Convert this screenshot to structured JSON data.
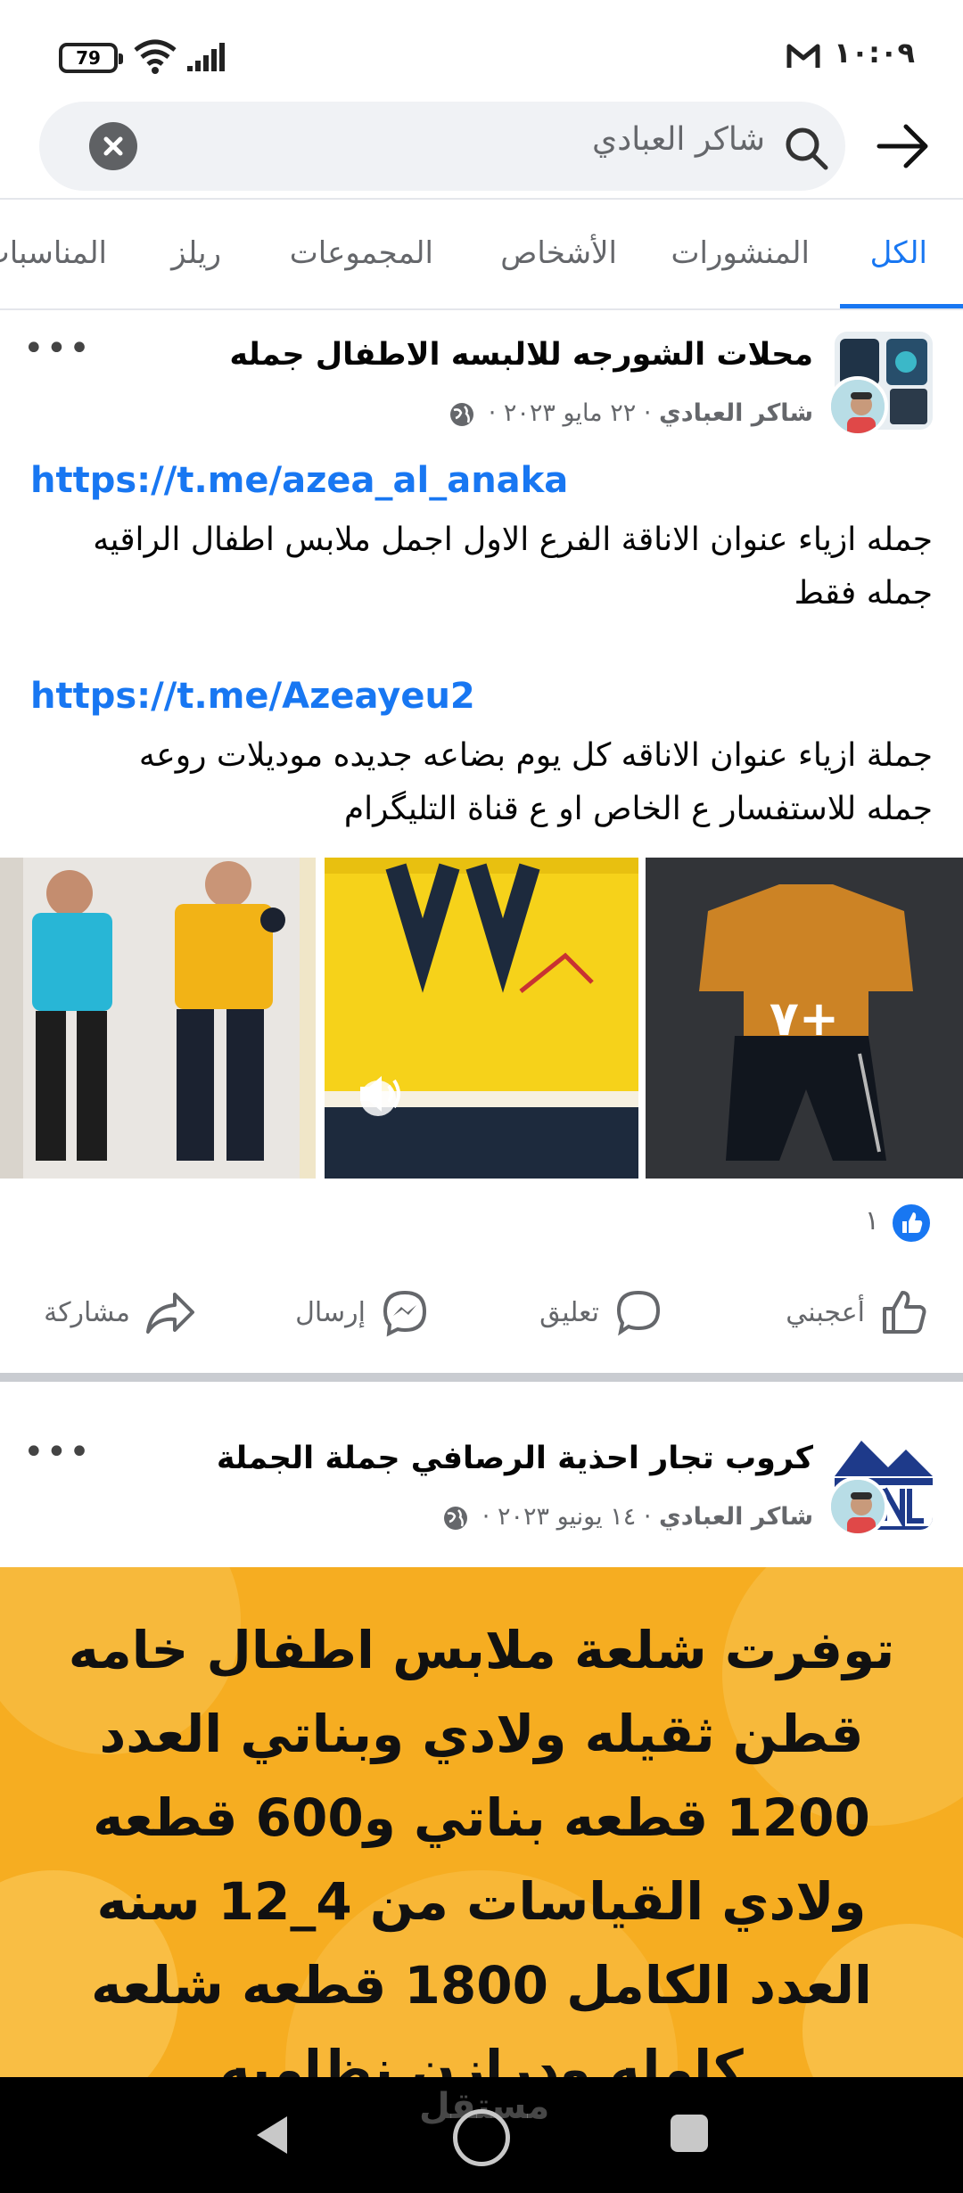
{
  "status_bar": {
    "battery": "79",
    "time": "١٠:٠٩"
  },
  "search": {
    "query": "شاكر العبادي"
  },
  "tabs": [
    {
      "label": "الكل",
      "active": true
    },
    {
      "label": "المنشورات"
    },
    {
      "label": "الأشخاص"
    },
    {
      "label": "المجموعات"
    },
    {
      "label": "ريلز"
    },
    {
      "label": "المناسبات"
    }
  ],
  "post1": {
    "group_name": "محلات الشورجه للالبسه الاطفال جمله",
    "author": "شاكر العبادي",
    "date": "· ٢٢ مايو ٢٠٢٣ ·",
    "link1": "https://t.me/azea_al_anaka",
    "text1_line1": "جمله ازياء عنوان الاناقة الفرع الاول اجمل ملابس اطفال الراقيه",
    "text1_line2": "جمله فقط",
    "link2": "https://t.me/Azeayeu2",
    "text2_line1": "جملة ازياء عنوان الاناقه كل يوم  بضاعه جديده موديلات روعه",
    "text2_line2": "جمله  للاستفسار ع الخاص او ع قناة التليگرام",
    "more_photos": "+٧",
    "reaction_count": "١",
    "actions": {
      "like": "أعجبني",
      "comment": "تعليق",
      "send": "إرسال",
      "share": "مشاركة"
    }
  },
  "post2": {
    "group_name": "كروب تجار احذية الرصافي جملة الجملة",
    "author": "شاكر العبادي",
    "date": "· ١٤ يونيو ٢٠٢٣ ·",
    "banner_lines": [
      "توفرت شلعة ملابس اطفال خامه",
      "قطن ثقيله  ولادي وبناتي العدد",
      "1200 قطعه بناتي و600 قطعه",
      "ولادي القياسات من 4_12 سنه",
      "العدد الكامل 1800 قطعه شلعه",
      "كامله ودرازن نظاميه"
    ]
  },
  "watermark": "مستقل"
}
